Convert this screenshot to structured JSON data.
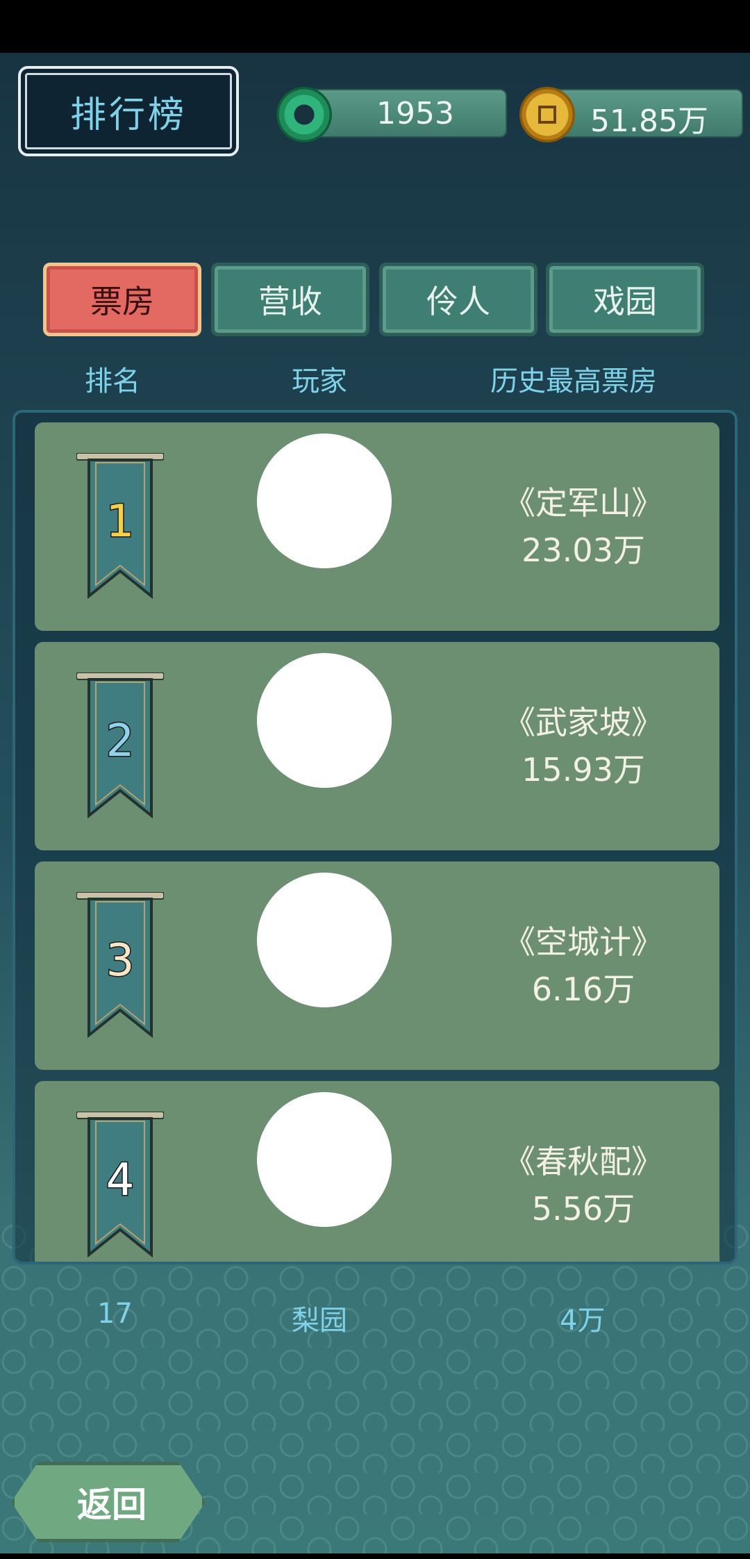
{
  "header": {
    "title": "排行榜",
    "jade": "1953",
    "coins": "51.85万"
  },
  "tabs": [
    {
      "label": "票房",
      "active": true
    },
    {
      "label": "营收",
      "active": false
    },
    {
      "label": "伶人",
      "active": false
    },
    {
      "label": "戏园",
      "active": false
    }
  ],
  "columns": {
    "rank": "排名",
    "player": "玩家",
    "record": "历史最高票房"
  },
  "rows": [
    {
      "rank": "1",
      "show": "《定军山》",
      "amount": "23.03万",
      "rank_color": "#f4d04a"
    },
    {
      "rank": "2",
      "show": "《武家坡》",
      "amount": "15.93万",
      "rank_color": "#8fd3ea"
    },
    {
      "rank": "3",
      "show": "《空城计》",
      "amount": "6.16万",
      "rank_color": "#f6e6c8"
    },
    {
      "rank": "4",
      "show": "《春秋配》",
      "amount": "5.56万",
      "rank_color": "#ffffff"
    }
  ],
  "my_rank": {
    "rank": "17",
    "player": "梨园",
    "record": "4万"
  },
  "back_button": "返回",
  "colors": {
    "accent": "#7fd2e8",
    "row_bg": "#6c8f71",
    "active_tab": "#e36a63"
  }
}
